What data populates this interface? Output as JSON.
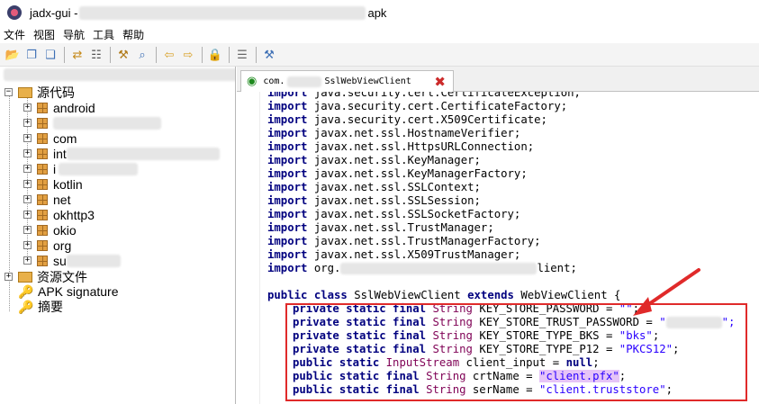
{
  "window": {
    "title_prefix": "jadx-gui - ",
    "title_suffix": "apk"
  },
  "menu": [
    "文件",
    "视图",
    "导航",
    "工具",
    "帮助"
  ],
  "toolbar": {
    "icons": [
      "open-icon",
      "copy-icon",
      "save-icon",
      "sync-icon",
      "tree-icon",
      "search-icon",
      "find-icon",
      "back-icon",
      "forward-icon",
      "lock-icon",
      "log-icon",
      "settings-icon"
    ]
  },
  "tree": {
    "root_label": "源代码",
    "packages": [
      "android",
      "",
      "com",
      "int",
      "i",
      "kotlin",
      "net",
      "okhttp3",
      "okio",
      "org",
      "su"
    ],
    "resources_label": "资源文件",
    "apk_signature_label": "APK signature",
    "summary_label": "摘要"
  },
  "tab": {
    "prefix": "com.",
    "class_name": "SslWebViewClient"
  },
  "code": {
    "imports": [
      "java.security.cert.CertificateException;",
      "java.security.cert.CertificateFactory;",
      "java.security.cert.X509Certificate;",
      "javax.net.ssl.HostnameVerifier;",
      "javax.net.ssl.HttpsURLConnection;",
      "javax.net.ssl.KeyManager;",
      "javax.net.ssl.KeyManagerFactory;",
      "javax.net.ssl.SSLContext;",
      "javax.net.ssl.SSLSession;",
      "javax.net.ssl.SSLSocketFactory;",
      "javax.net.ssl.TrustManager;",
      "javax.net.ssl.TrustManagerFactory;",
      "javax.net.ssl.X509TrustManager;"
    ],
    "import_kw": "import",
    "last_import_prefix": "org.",
    "last_import_suffix": "lient;",
    "class_decl": {
      "kw1": "public class",
      "name": "SslWebViewClient",
      "kw2": "extends",
      "parent": "WebViewClient {"
    },
    "fields": [
      {
        "mods": "private static final",
        "type": "String",
        "name": "KEY_STORE_PASSWORD",
        "eq": " = ",
        "value": "\"\"",
        "end": ";"
      },
      {
        "mods": "private static final",
        "type": "String",
        "name": "KEY_STORE_TRUST_PASSWORD",
        "eq": " = ",
        "value": "\"",
        "end": "\";"
      },
      {
        "mods": "private static final",
        "type": "String",
        "name": "KEY_STORE_TYPE_BKS",
        "eq": " = ",
        "value": "\"bks\"",
        "end": ";"
      },
      {
        "mods": "private static final",
        "type": "String",
        "name": "KEY_STORE_TYPE_P12",
        "eq": " = ",
        "value": "\"PKCS12\"",
        "end": ";"
      },
      {
        "mods": "public static",
        "type": "InputStream",
        "name": "client_input",
        "eq": " = ",
        "value": "null",
        "end": ";"
      },
      {
        "mods": "public static final",
        "type": "String",
        "name": "crtName",
        "eq": " = ",
        "value": "\"client.pfx\"",
        "end": ";"
      },
      {
        "mods": "public static final",
        "type": "String",
        "name": "serName",
        "eq": " = ",
        "value": "\"client.truststore\"",
        "end": ";"
      }
    ]
  },
  "colors": {
    "keyword": "#00007f",
    "type": "#7f0055",
    "string": "#2a00ff",
    "annotation_box": "#e02a2a"
  }
}
